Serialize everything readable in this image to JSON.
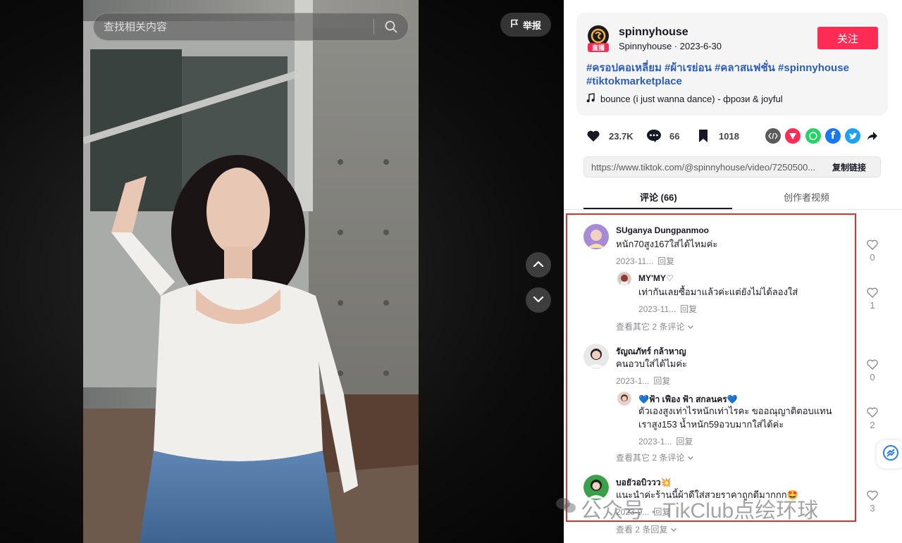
{
  "search": {
    "placeholder": "查找相关内容"
  },
  "report_label": "举报",
  "author": {
    "username": "spinnyhouse",
    "nickname": "Spinnyhouse",
    "date": "2023-6-30",
    "live_badge": "直播",
    "follow_label": "关注"
  },
  "description": {
    "hashtags": "#ครอปคอเหลี่ยม #ผ้าเรย่อน #คลาสแฟชั่น #spinnyhouse #tiktokmarketplace",
    "music": "bounce (i just wanna dance) - фрози & joyful"
  },
  "stats": {
    "likes": "23.7K",
    "comments": "66",
    "saves": "1018"
  },
  "share_icons": [
    "embed-icon",
    "send-icon",
    "whatsapp-icon",
    "facebook-icon",
    "twitter-icon",
    "forward-icon"
  ],
  "link": {
    "url": "https://www.tiktok.com/@spinnyhouse/video/7250500...",
    "copy_label": "复制链接"
  },
  "tabs": [
    {
      "label": "评论 (66)"
    },
    {
      "label": "创作者视频"
    }
  ],
  "comments": [
    {
      "name": "SUganya Dungpanmoo",
      "text": "หนัก70สูง167ใส่ได้ไหมค่ะ",
      "time": "2023-11...",
      "reply": "回复",
      "likes": "0"
    },
    {
      "name": "MY'MY♡",
      "text": "เท่ากันเลยซื้อมาแล้วค่ะแต่ยังไม่ได้ลองใส่",
      "time": "2023-11...",
      "reply": "回复",
      "likes": "1"
    },
    {
      "more": "查看其它 2 条评论"
    },
    {
      "name": "รัญณภัทร์ กล้าหาญ",
      "text": "คนอวบใส่ได้ไมค่ะ",
      "time": "2023-1...",
      "reply": "回复",
      "likes": "0"
    },
    {
      "name": "💙ฟ้า เฟือง ฟ้า สกลนคร💙",
      "text1": "ตัวเองสูงเท่าไรหนักเท่าไรคะ ขออณุญาติตอบแทน",
      "text2": "เราสูง153 น้ำหนัก59อวบมากใส่ได้ค่ะ",
      "time": "2023-1...",
      "reply": "回复",
      "likes": "2"
    },
    {
      "more": "查看其它 2 条评论"
    },
    {
      "name": "บอยัวอบิววว💥",
      "text": "แนะนำค่ะร้านนี้ผ้าดีใส่สวยราคาถูกดีมากกก🤩",
      "time": "2023-9...",
      "reply": "回复",
      "likes": "3"
    },
    {
      "more": "查看 2 条回复"
    }
  ],
  "watermark": "公众号 · TikClub点绘环球",
  "colors": {
    "accent": "#fe2c55",
    "hashtag": "#2b5db9",
    "highlight_box": "#e0312a"
  }
}
